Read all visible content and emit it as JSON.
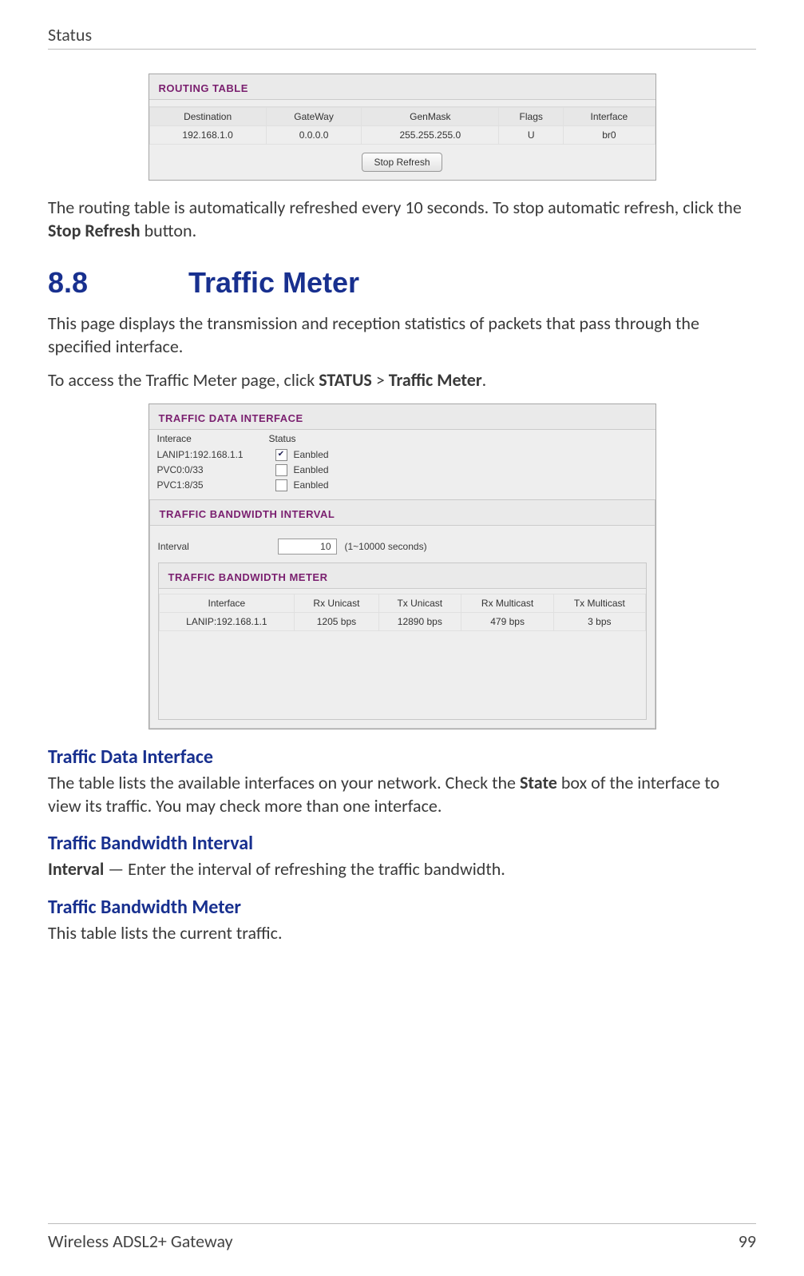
{
  "header": {
    "title": "Status"
  },
  "routing": {
    "title": "ROUTING TABLE",
    "columns": [
      "Destination",
      "GateWay",
      "GenMask",
      "Flags",
      "Interface"
    ],
    "rows": [
      {
        "c0": "192.168.1.0",
        "c1": "0.0.0.0",
        "c2": "255.255.255.0",
        "c3": "U",
        "c4": "br0"
      }
    ],
    "button": "Stop Refresh"
  },
  "para1a": "The routing table is automatically refreshed every 10 seconds. To stop automatic refresh, click the ",
  "para1b": "Stop Refresh",
  "para1c": " button.",
  "section": {
    "num": "8.8",
    "title": "Traffic Meter"
  },
  "para2": "This page displays the transmission and reception statistics of packets that pass through the specified interface.",
  "para3a": "To access the Traffic Meter page, click ",
  "para3b": "STATUS",
  "para3c": " > ",
  "para3d": "Traffic Meter",
  "para3e": ".",
  "traffic": {
    "title1": "TRAFFIC DATA INTERFACE",
    "head": {
      "c1": "Interace",
      "c2": "Status"
    },
    "ifaces": [
      {
        "name": "LANIP1:192.168.1.1",
        "checked": true,
        "label": "Eanbled"
      },
      {
        "name": "PVC0:0/33",
        "checked": false,
        "label": "Eanbled"
      },
      {
        "name": "PVC1:8/35",
        "checked": false,
        "label": "Eanbled"
      }
    ],
    "title2": "TRAFFIC BANDWIDTH INTERVAL",
    "interval": {
      "label": "Interval",
      "value": "10",
      "hint": "(1~10000 seconds)"
    },
    "title3": "TRAFFIC BANDWIDTH METER",
    "meter_cols": [
      "Interface",
      "Rx Unicast",
      "Tx Unicast",
      "Rx Multicast",
      "Tx Multicast"
    ],
    "meter_rows": [
      {
        "c0": "LANIP:192.168.1.1",
        "c1": "1205 bps",
        "c2": "12890 bps",
        "c3": "479 bps",
        "c4": "3 bps"
      }
    ]
  },
  "sub1": {
    "heading": "Traffic Data Interface",
    "p_a": "The table lists the available interfaces on your network. Check the ",
    "p_b": "State",
    "p_c": " box of the interface to view its traffic. You may check more than one interface."
  },
  "sub2": {
    "heading": "Traffic Bandwidth Interval",
    "p_a": "Interval",
    "p_b": " — Enter the interval of refreshing the traffic bandwidth."
  },
  "sub3": {
    "heading": "Traffic Bandwidth Meter",
    "p": "This table lists the current traffic."
  },
  "footer": {
    "left": "Wireless ADSL2+ Gateway",
    "right": "99"
  }
}
